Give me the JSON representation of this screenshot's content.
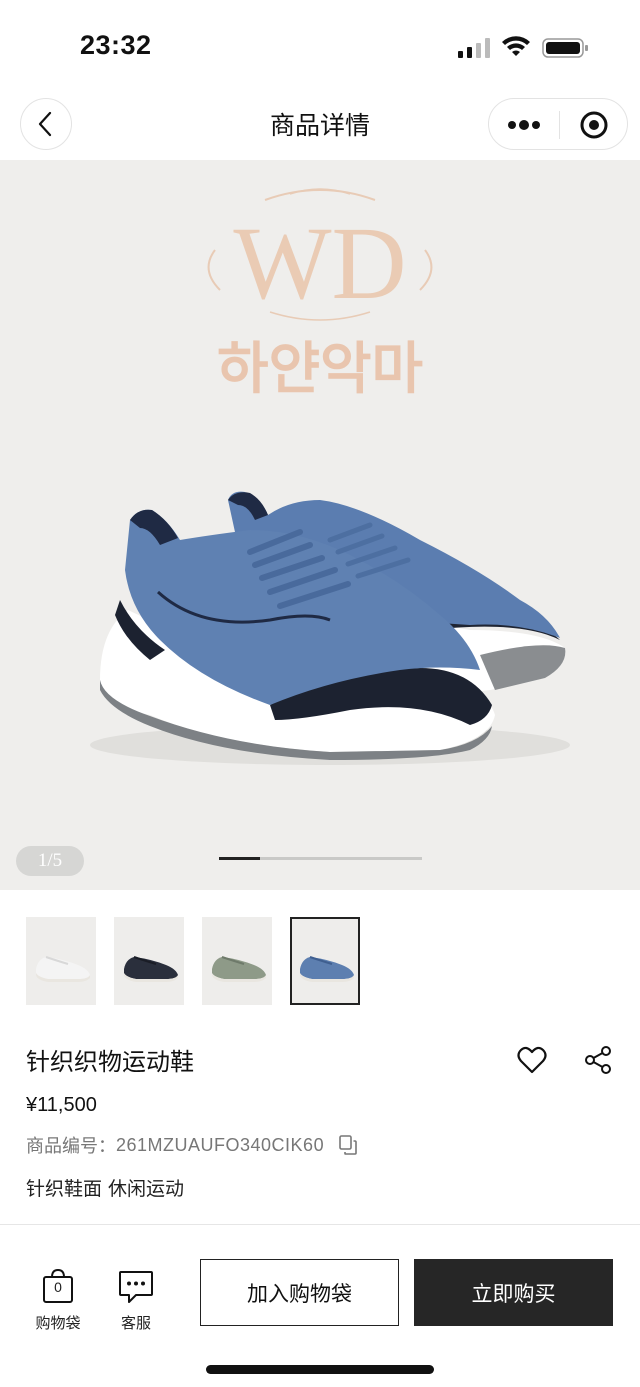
{
  "status_bar": {
    "time": "23:32"
  },
  "nav": {
    "title": "商品详情"
  },
  "hero": {
    "image_subject": "blue knit slip-on sneaker",
    "watermark_text": "하얀악마",
    "watermark_logo": "WD",
    "counter": "1/5",
    "progress_fraction": 0.2
  },
  "thumbnails": [
    {
      "color": "white",
      "active": false
    },
    {
      "color": "navy",
      "active": false
    },
    {
      "color": "sage",
      "active": false
    },
    {
      "color": "blue",
      "active": true
    }
  ],
  "product": {
    "name": "针织织物运动鞋",
    "price": "¥11,500",
    "sku_label": "商品编号：",
    "sku_value": "261MZUAUFO340CIK60",
    "description": "针织鞋面 休闲运动"
  },
  "bottom_bar": {
    "bag_label": "购物袋",
    "bag_count": "0",
    "service_label": "客服",
    "add_to_bag_label": "加入购物袋",
    "buy_now_label": "立即购买"
  },
  "icons": {
    "back": "chevron-left-icon",
    "more": "more-dots-icon",
    "close": "target-close-icon",
    "favorite": "heart-icon",
    "share": "share-icon",
    "copy": "copy-icon",
    "bag": "shopping-bag-icon",
    "service": "chat-icon"
  },
  "colors": {
    "accent": "#262626",
    "hero_bg": "#efeeec",
    "shoe_blue": "#5d7fb0",
    "watermark": "#e7b89a"
  }
}
